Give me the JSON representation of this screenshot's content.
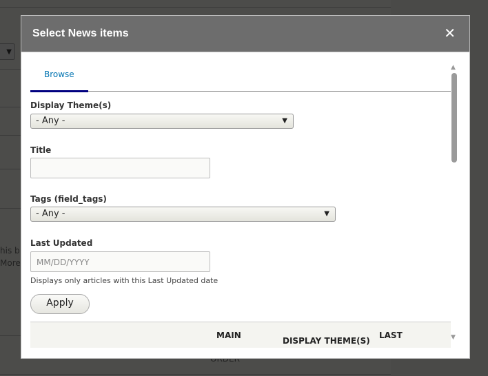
{
  "background": {
    "text_line1": "his b",
    "text_line2": "More",
    "order_label": "ORDER"
  },
  "dialog": {
    "title": "Select News items",
    "close_icon": "close-icon",
    "tabs": [
      {
        "label": "Browse",
        "active": true
      }
    ],
    "filters": {
      "display_theme": {
        "label": "Display Theme(s)",
        "value": "- Any -"
      },
      "title": {
        "label": "Title",
        "value": ""
      },
      "tags": {
        "label": "Tags (field_tags)",
        "value": "- Any -"
      },
      "last_updated": {
        "label": "Last Updated",
        "placeholder": "MM/DD/YYYY",
        "description": "Displays only articles with this Last Updated date"
      }
    },
    "apply_label": "Apply",
    "table_headers": [
      "MAIN",
      "DISPLAY THEME(S)",
      "LAST"
    ]
  },
  "colors": {
    "accent": "#0073b1",
    "tab_underline": "#000080",
    "titlebar": "#6d6d6d"
  }
}
